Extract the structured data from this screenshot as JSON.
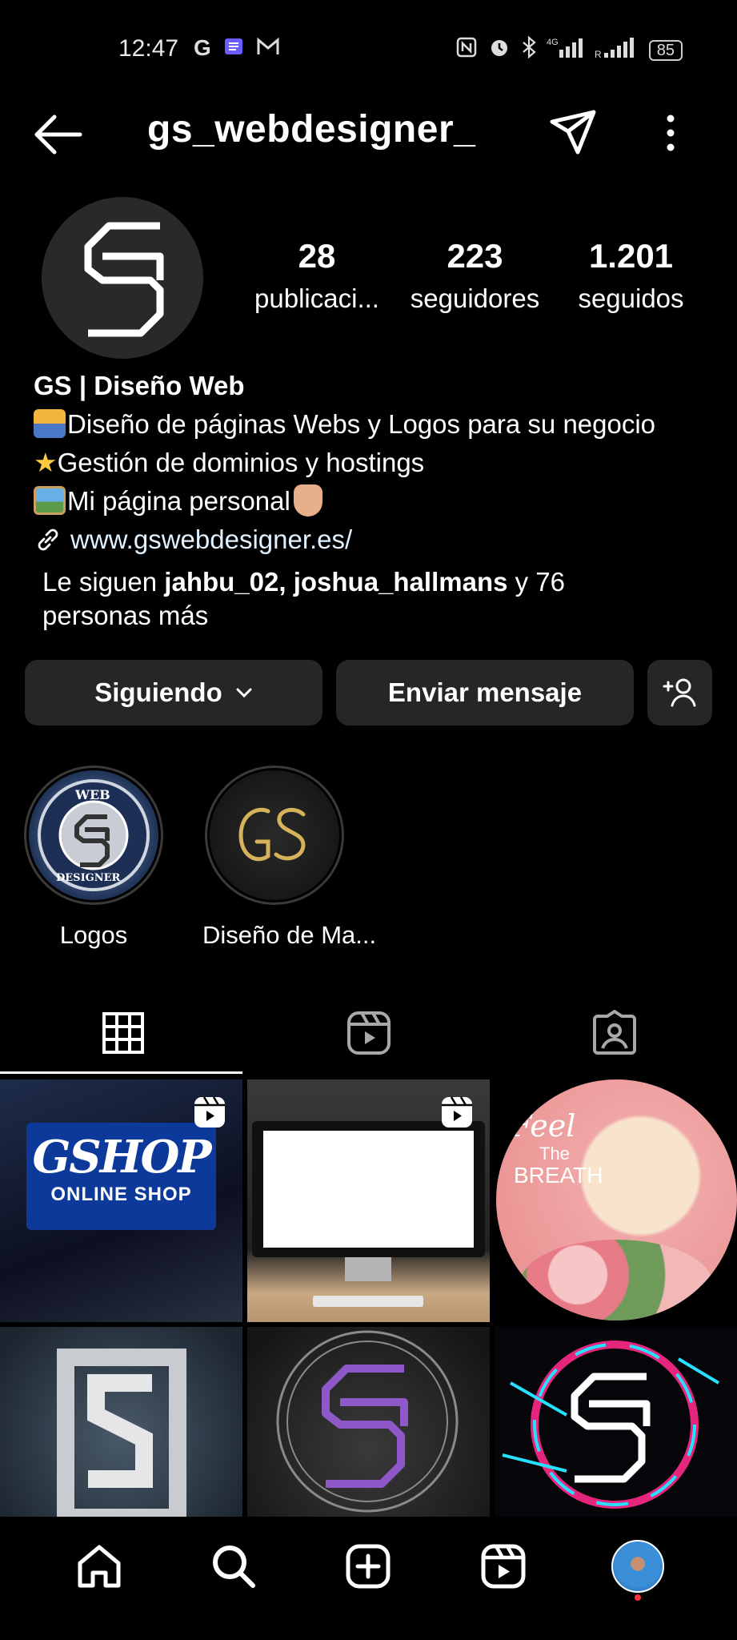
{
  "status_bar": {
    "time": "12:47",
    "left_icons": [
      "google-icon",
      "notes-icon",
      "gmail-icon"
    ],
    "right_icons": [
      "nfc-icon",
      "alarm-icon",
      "bluetooth-icon",
      "4g-signal-icon",
      "signal-icon"
    ],
    "battery": "85"
  },
  "header": {
    "username": "gs_webdesigner_"
  },
  "profile": {
    "stats": [
      {
        "value": "28",
        "label": "publicaci..."
      },
      {
        "value": "223",
        "label": "seguidores"
      },
      {
        "value": "1.201",
        "label": "seguidos"
      }
    ],
    "bio": {
      "name": "GS | Diseño Web",
      "line1": "Diseño de páginas Webs y Logos para su negocio",
      "line2": "Gestión de dominios y hostings",
      "line3": "Mi página personal",
      "link": "www.gswebdesigner.es/"
    },
    "followed_by": {
      "prefix": "Le siguen ",
      "user1": "jahbu_02",
      "sep": ", ",
      "user2": "joshua_hallmans",
      "suffix": " y 76 personas más"
    }
  },
  "actions": {
    "following_label": "Siguiendo",
    "message_label": "Enviar mensaje"
  },
  "highlights": [
    {
      "label": "Logos"
    },
    {
      "label": "Diseño de Ma..."
    }
  ],
  "posts": {
    "post1": {
      "brand": "GSHOP",
      "sub": "ONLINE SHOP"
    },
    "post3": {
      "line1": "Feel",
      "line2": "The",
      "line3": "BREATH"
    }
  },
  "colors": {
    "background": "#000000",
    "button_bg": "#262626",
    "accent_dot": "#ff3040",
    "link": "#e0f1ff"
  }
}
